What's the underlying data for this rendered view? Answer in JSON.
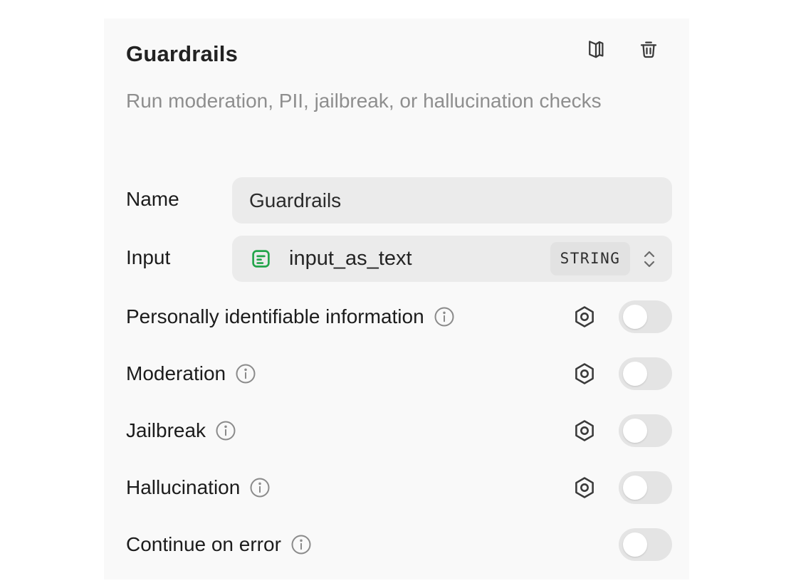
{
  "panel": {
    "title": "Guardrails",
    "description": "Run moderation, PII, jailbreak, or hallucination checks",
    "header_icons": [
      "book-icon",
      "trash-icon"
    ]
  },
  "form": {
    "name_label": "Name",
    "name_value": "Guardrails",
    "input_label": "Input",
    "input_value": "input_as_text",
    "input_type": "STRING",
    "input_icon": "text-variable-icon",
    "input_icon_color": "#22a44a"
  },
  "guardrails": [
    {
      "label": "Personally identifiable information",
      "has_settings": true,
      "enabled": false
    },
    {
      "label": "Moderation",
      "has_settings": true,
      "enabled": false
    },
    {
      "label": "Jailbreak",
      "has_settings": true,
      "enabled": false
    },
    {
      "label": "Hallucination",
      "has_settings": true,
      "enabled": false
    },
    {
      "label": "Continue on error",
      "has_settings": false,
      "enabled": false
    }
  ],
  "colors": {
    "panel_bg": "#f9f9f9",
    "field_bg": "#ebebeb",
    "toggle_off": "#e4e4e4",
    "muted_text": "#8e8e8e"
  }
}
